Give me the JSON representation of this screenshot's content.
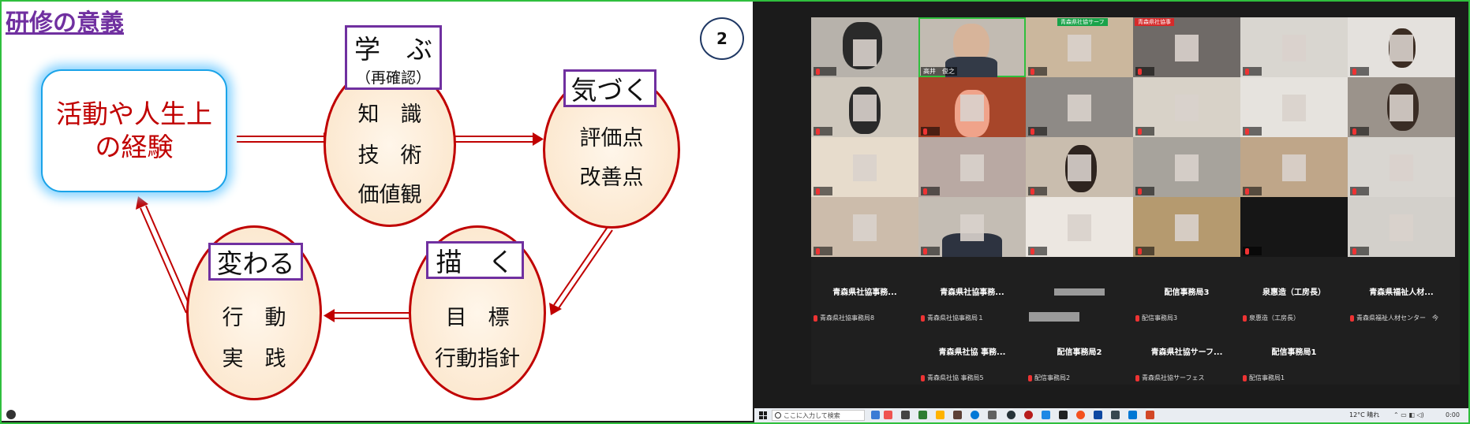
{
  "slide": {
    "title": "研修の意義",
    "page_number": "2",
    "experience_box": "活動や人生上\nの経験",
    "learn": {
      "tag": "学　ぶ",
      "sub": "（再確認）",
      "lines": [
        "知　識",
        "技　術",
        "価値観"
      ]
    },
    "notice": {
      "tag": "気づく",
      "lines": [
        "評価点",
        "改善点"
      ]
    },
    "draw": {
      "tag": "描　く",
      "lines": [
        "目　標",
        "行動指針"
      ]
    },
    "change": {
      "tag": "変わる",
      "lines": [
        "行　動",
        "実　践"
      ]
    }
  },
  "gallery": {
    "speaker_top_labels": [
      "青森県社協サーフ",
      "青森県社協事"
    ],
    "speaker_name": "高井　俊之",
    "name_tiles": [
      {
        "title": "青森県社協事務...",
        "sub": "青森県社協事務局8"
      },
      {
        "title": "青森県社協事務...",
        "sub": "青森県社協事務局１"
      },
      {
        "title": "",
        "sub": ""
      },
      {
        "title": "配信事務局3",
        "sub": "配信事務局3"
      },
      {
        "title": "泉惠造（工房長）",
        "sub": "泉惠造（工房長）"
      },
      {
        "title": "青森県福祉人材...",
        "sub": "青森県福祉人材センター　今"
      },
      {
        "title": "青森県社協 事務...",
        "sub": "青森県社協 事務局5"
      },
      {
        "title": "配信事務局2",
        "sub": "配信事務局2"
      },
      {
        "title": "青森県社協サーフ...",
        "sub": "青森県社協サーフェス"
      },
      {
        "title": "配信事務局1",
        "sub": "配信事務局1"
      }
    ]
  },
  "taskbar": {
    "search_placeholder": "ここに入力して検索",
    "weather": "12°C 晴れ",
    "time": "0:00"
  },
  "colors": {
    "accent_green": "#2fbf3d",
    "slide_title": "#7030a0",
    "cycle_red": "#c00000",
    "box_blue": "#1aa3e8"
  }
}
